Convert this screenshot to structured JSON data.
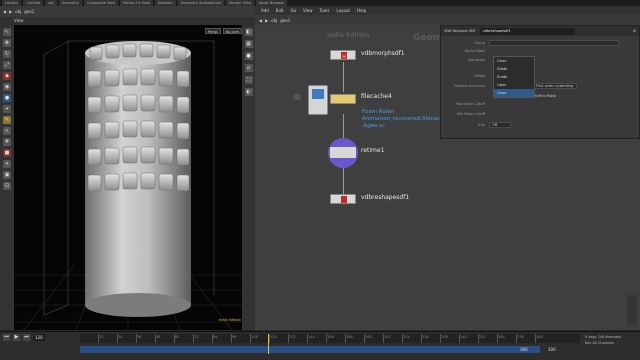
{
  "top_tabs": [
    "Houdini",
    "Untitled",
    "obj",
    "Geometry",
    "Composite View",
    "Motion FX View",
    "Network",
    "Geometry Spreadsheet",
    "Render View",
    "Asset Browser"
  ],
  "viewer": {
    "path": [
      "obj",
      "geo1"
    ],
    "tab_label": "View",
    "persp_button": "Persp",
    "cam_button": "No cam",
    "status": "Indie Edition"
  },
  "network": {
    "menu": [
      "Add",
      "Edit",
      "Go",
      "View",
      "Tools",
      "Layout",
      "Help"
    ],
    "path": [
      "obj",
      "geo1"
    ],
    "context_label": "Geometry",
    "sub_label": "Indie Edition",
    "nodes": [
      {
        "name": "vdbmorphsdf1"
      },
      {
        "name": "filecache4",
        "comment_lines": [
          "Foam Roller",
          "Animation_recovered.filecache4",
          ".bgeo.sc"
        ]
      },
      {
        "name": "retime1"
      },
      {
        "name": "vdbreshapesdf1"
      }
    ]
  },
  "params": {
    "type_label": "VDB Reshape SDF",
    "node_name": "vdbreshapesdf1",
    "rows": [
      {
        "label": "Group",
        "value": ""
      },
      {
        "label": "Alpha Mask",
        "value": ""
      },
      {
        "label": "Operation",
        "value": "Close"
      },
      {
        "label": "Offset",
        "value": ""
      },
      {
        "label": "Renorm Accuracy",
        "value": "First-order upwinding"
      },
      {
        "label": "Max Mask Cutoff",
        "value": ""
      },
      {
        "label": "Min Mask Cutoff",
        "value": ""
      },
      {
        "label": "Trim",
        "value": "Off"
      }
    ],
    "dropdown": [
      "Dilate",
      "Erode",
      "Open",
      "Close"
    ],
    "dropdown_hint": "orld Space Units",
    "mask_hint": "cutoff to Mask"
  },
  "timeline": {
    "frame": "120",
    "ticks": [
      "12",
      "24",
      "36",
      "48",
      "60",
      "72",
      "84",
      "96",
      "108",
      "120",
      "132",
      "144",
      "156",
      "168",
      "180",
      "192",
      "204",
      "216",
      "228",
      "240",
      "252",
      "264",
      "276",
      "288"
    ],
    "end_a": "300",
    "end_b": "300",
    "keys_line1": "0 keys, 0/0 channels",
    "keys_line2": "Key All Channels"
  },
  "colors": {
    "viewport_bg": "#050505",
    "network_bg": "#3f3f3f",
    "range_bar": "#2a4f86",
    "playhead": "#e1c33a",
    "selected": "#2e5b8a"
  }
}
